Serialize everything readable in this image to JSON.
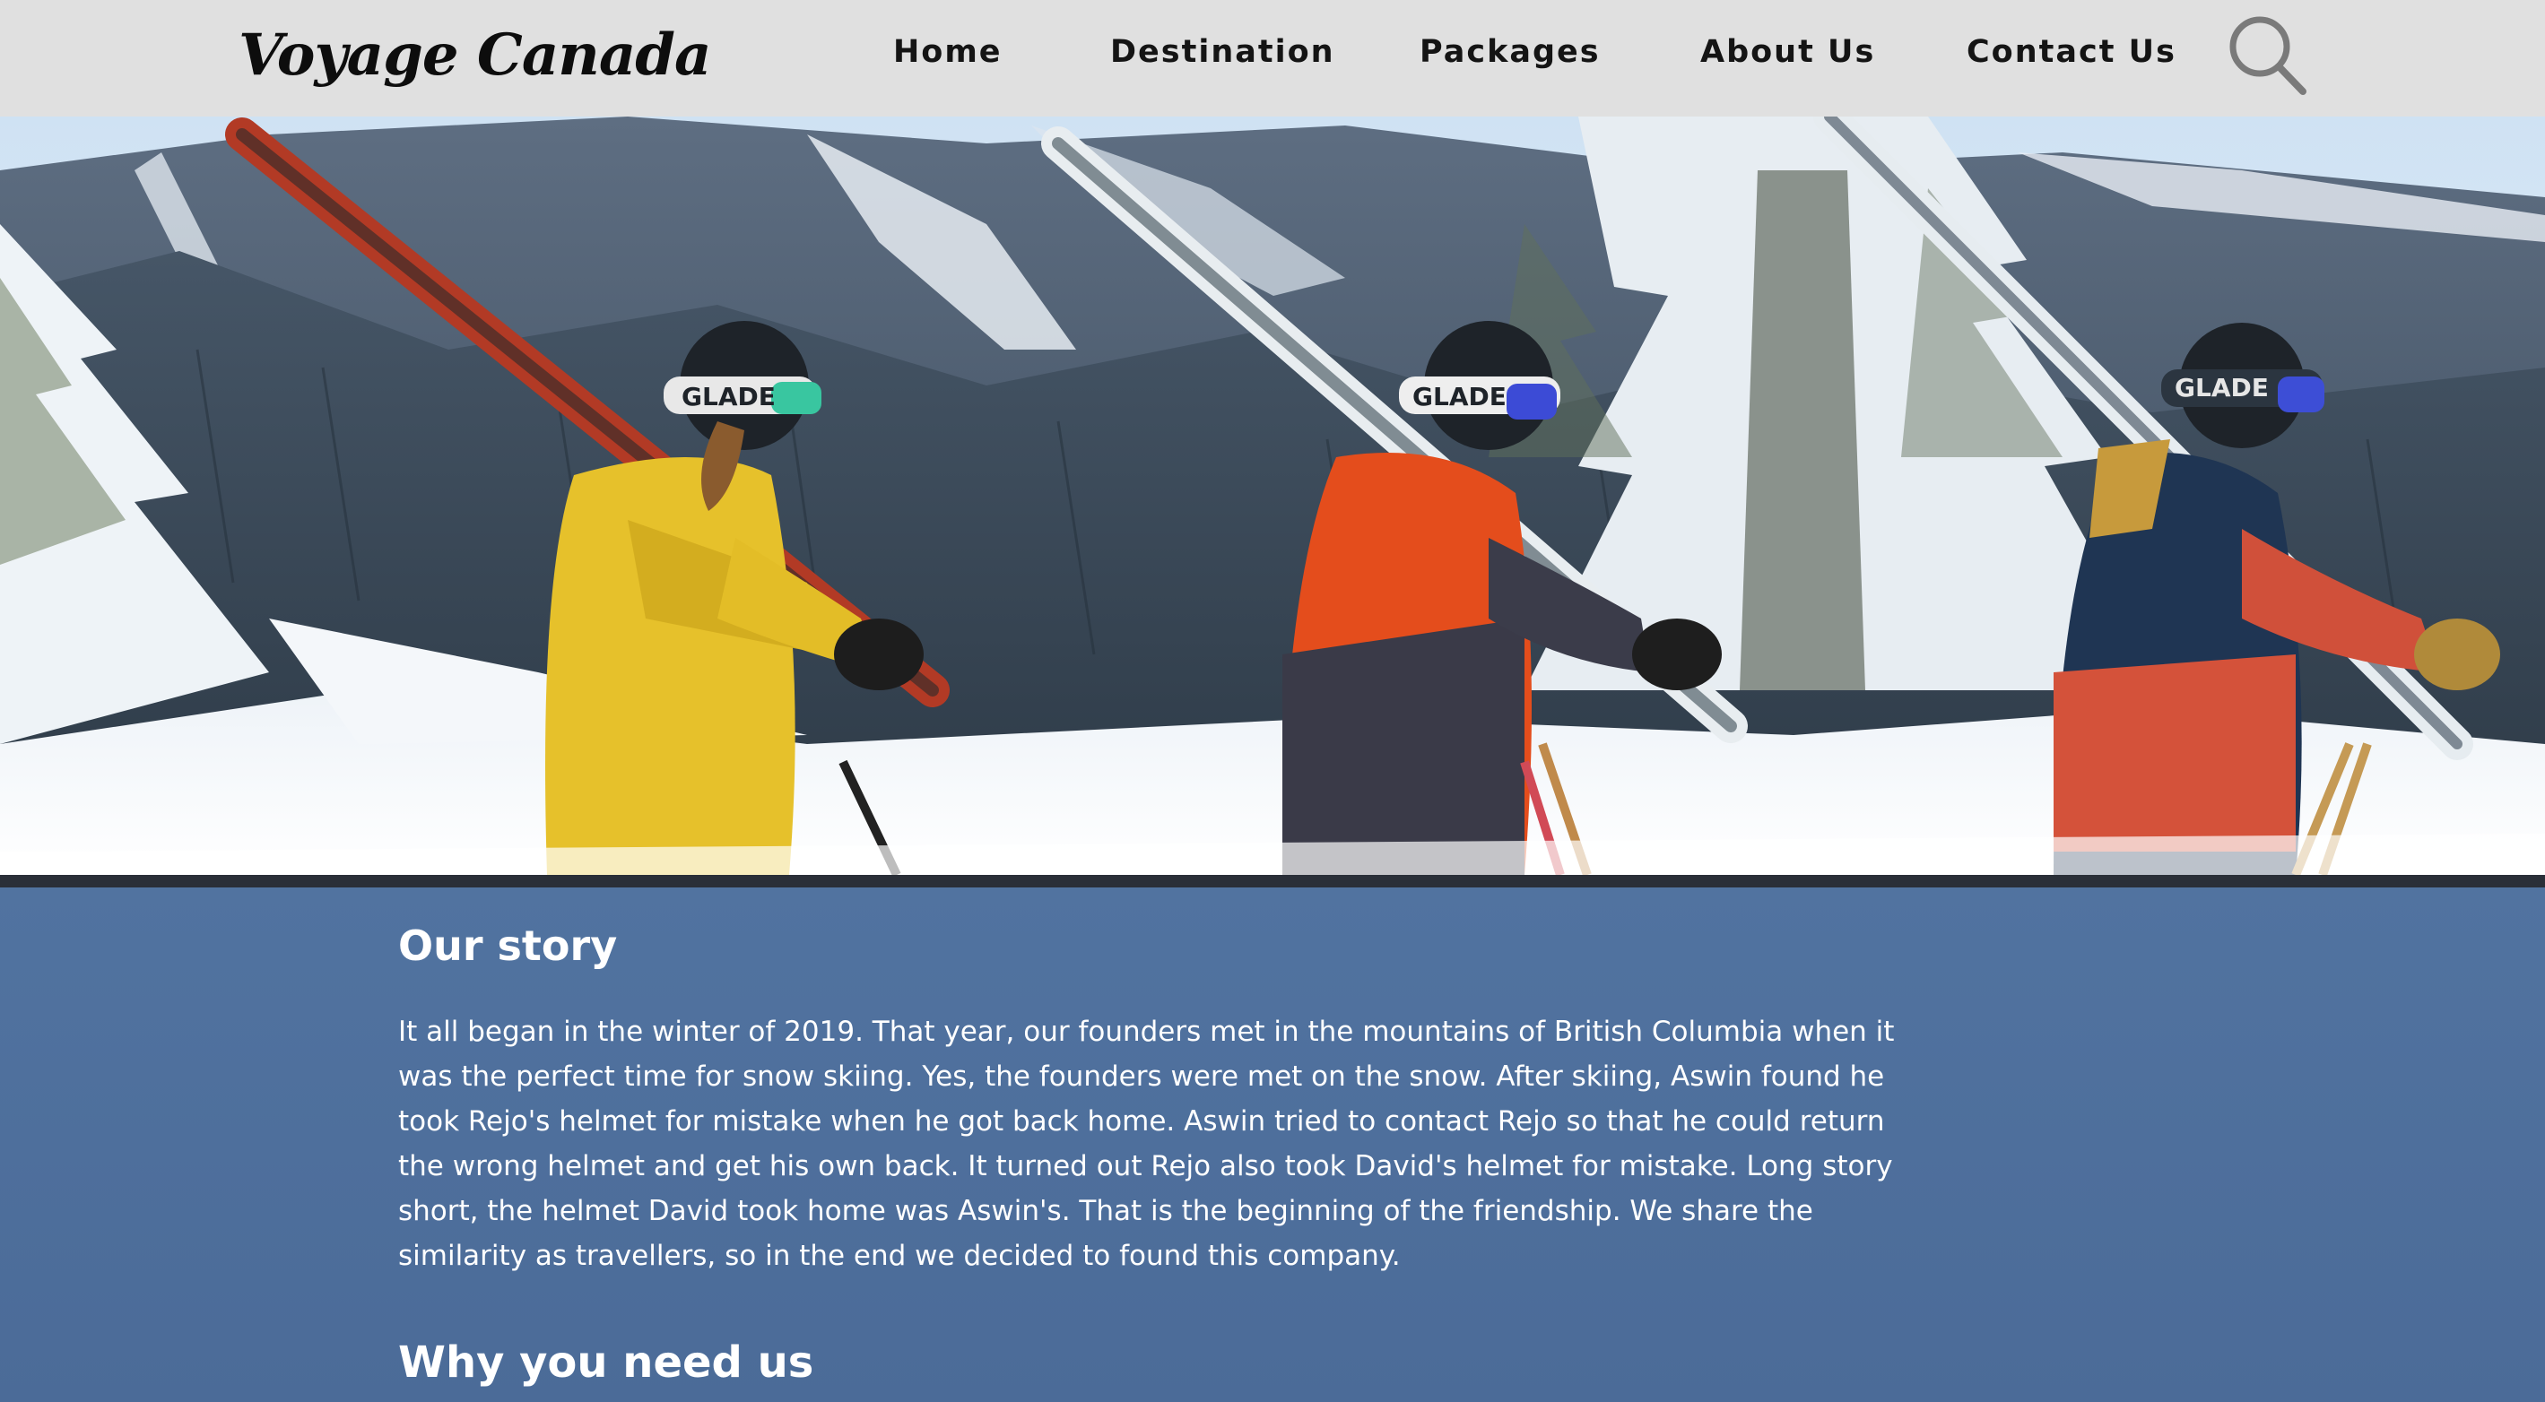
{
  "header": {
    "brand": "Voyage Canada",
    "nav": [
      {
        "label": "Home"
      },
      {
        "label": "Destination"
      },
      {
        "label": "Packages"
      },
      {
        "label": "About Us"
      },
      {
        "label": "Contact Us"
      }
    ],
    "search_icon": "search-icon"
  },
  "hero": {
    "image": "three skiers carrying skis across a snowy mountain ridge"
  },
  "story": {
    "heading": "Our story",
    "body": "It all began in the winter of 2019. That year, our founders met in the mountains of British Columbia when it was the perfect time for snow skiing. Yes, the founders were met on the snow. After skiing, Aswin found he took Rejo's helmet for mistake when he got back home. Aswin tried to contact Rejo so that he could return the wrong helmet and get his own back. It turned out Rejo also took David's helmet for mistake. Long story short, the helmet David took home was Aswin's. That is the beginning of the friendship. We share the similarity as travellers, so in the end we decided to found this company."
  },
  "why": {
    "heading": "Why you need us"
  },
  "colors": {
    "navbar_bg": "#e0e0e0",
    "content_bg": "#5173a0",
    "text_light": "#ffffff",
    "text_dark": "#141414"
  }
}
